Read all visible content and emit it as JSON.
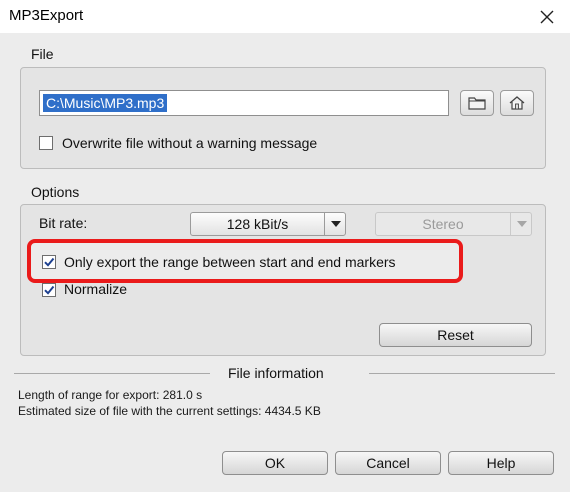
{
  "window": {
    "title": "MP3Export",
    "close_icon": "close-icon"
  },
  "file_section": {
    "label": "File",
    "path_value": "C:\\Music\\MP3.mp3",
    "browse_icon": "folder-icon",
    "home_icon": "home-icon",
    "overwrite_label": "Overwrite file without a warning message",
    "overwrite_checked": false
  },
  "options_section": {
    "label": "Options",
    "bitrate_label": "Bit rate:",
    "bitrate_value": "128 kBit/s",
    "channel_value": "Stereo",
    "channel_enabled": false,
    "range_only_label": "Only export the range between start and end markers",
    "range_only_checked": true,
    "normalize_label": "Normalize",
    "normalize_checked": true,
    "reset_label": "Reset",
    "highlight_color": "#ea1b1b"
  },
  "file_info": {
    "label": "File information",
    "length_text": "Length of range for export: 281.0 s",
    "size_text": "Estimated size of file with the current settings: 4434.5 KB"
  },
  "buttons": {
    "ok_label": "OK",
    "cancel_label": "Cancel",
    "help_label": "Help"
  }
}
